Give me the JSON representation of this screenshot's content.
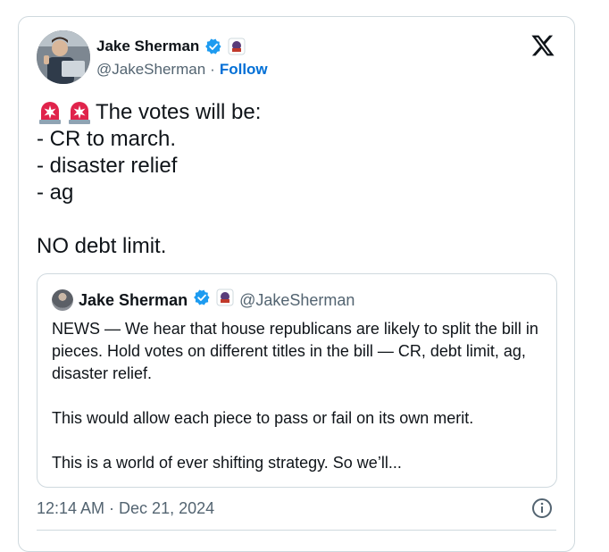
{
  "author": {
    "name": "Jake Sherman",
    "handle": "@JakeSherman",
    "separator": "·",
    "follow_label": "Follow"
  },
  "tweet": {
    "lines": [
      "The votes will be:",
      "- CR to march.",
      "- disaster relief",
      "- ag",
      "",
      "NO debt limit."
    ],
    "timestamp": "12:14 AM · Dec 21, 2024"
  },
  "quoted_tweet": {
    "name": "Jake Sherman",
    "handle": "@JakeSherman",
    "paragraphs": [
      "NEWS — We hear that house republicans are likely to split the bill in pieces. Hold votes on different titles in the bill — CR, debt limit, ag, disaster relief.",
      "This would allow each piece to pass or fail on its own merit.",
      "This is a world of ever shifting strategy. So we’ll..."
    ]
  },
  "icons": {
    "verified": "verified-badge-icon",
    "affiliate": "affiliate-badge-icon",
    "platform": "x-logo-icon",
    "info": "info-icon",
    "alarm": "rotating-light-emoji"
  },
  "colors": {
    "verified_blue": "#1d9bf0",
    "follow_blue": "#006fd6",
    "muted": "#536471",
    "border": "#cfd9de",
    "alarm_red": "#e0234b"
  }
}
